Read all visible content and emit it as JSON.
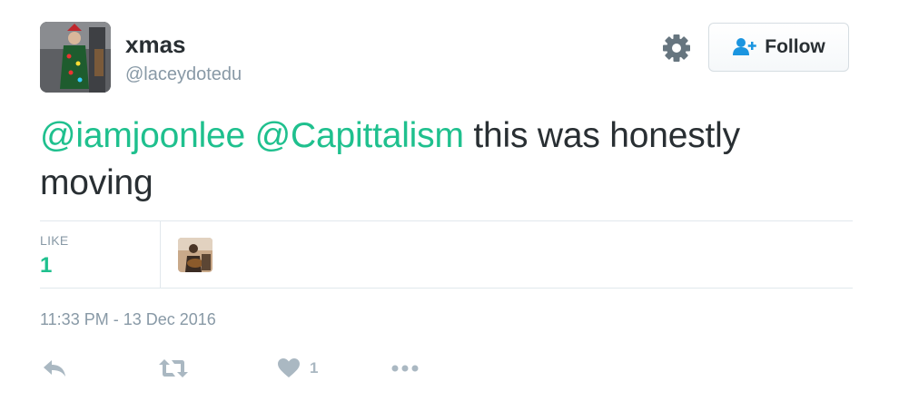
{
  "user": {
    "name": "xmas",
    "handle": "@laceydotedu"
  },
  "follow_button": {
    "label": "Follow"
  },
  "tweet": {
    "mentions": [
      "@iamjoonlee",
      "@Capittalism"
    ],
    "text": "this was honestly moving"
  },
  "stats": {
    "like_label": "LIKE",
    "like_count": "1"
  },
  "timestamp": "11:33 PM - 13 Dec 2016",
  "actions": {
    "like_count": "1"
  },
  "colors": {
    "accent": "#1fc08e",
    "text": "#292f33",
    "muted": "#8899a6",
    "icon": "#aab8c2",
    "divider": "#e1e8ed"
  }
}
